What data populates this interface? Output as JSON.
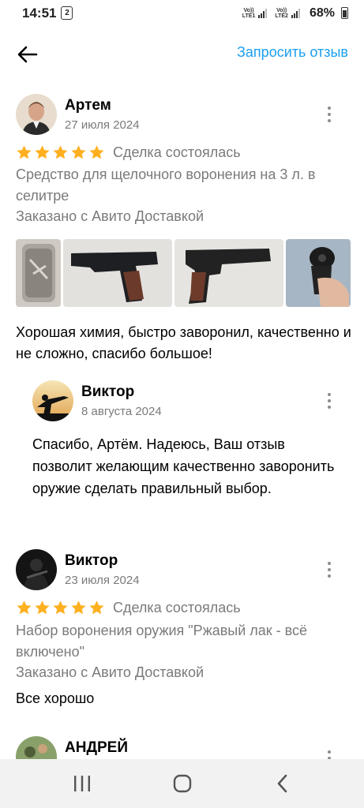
{
  "status_bar": {
    "time": "14:51",
    "sim_badge": "2",
    "sim1_label_top": "Vo))",
    "sim1_label_bottom": "LTE1",
    "sim2_label_top": "Vo))",
    "sim2_label_bottom": "LTE2",
    "battery": "68%"
  },
  "header": {
    "back_icon": "arrow-left-icon",
    "request_label": "Запросить отзыв"
  },
  "colors": {
    "accent": "#1a9ff0",
    "star": "#ffb021",
    "muted_text": "#7a7a7a"
  },
  "reviews": [
    {
      "author": "Артем",
      "date": "27 июля 2024",
      "rating": 5,
      "deal_status": "Сделка состоялась",
      "product": "Средство для щелочного воронения на 3 л. в селитре",
      "delivery": "Заказано с Авито Доставкой",
      "photo_count": 4,
      "text": "Хорошая химия, быстро заворонил, качественно и не сложно, спасибо большое!",
      "reply": {
        "author": "Виктор",
        "date": "8 августа 2024",
        "text": "Спасибо, Артём. Надеюсь, Ваш отзыв позволит желающим качественно заворонить оружие сделать правильный выбор."
      }
    },
    {
      "author": "Виктор",
      "date": "23 июля 2024",
      "rating": 5,
      "deal_status": "Сделка состоялась",
      "product": "Набор воронения оружия \"Ржавый лак - всё включено\"",
      "delivery": "Заказано с Авито Доставкой",
      "text": "Все хорошо"
    },
    {
      "author": "АНДРЕЙ"
    }
  ],
  "navbar": {
    "recent_icon": "recent-apps-icon",
    "home_icon": "home-icon",
    "back_icon": "back-chevron-icon"
  }
}
